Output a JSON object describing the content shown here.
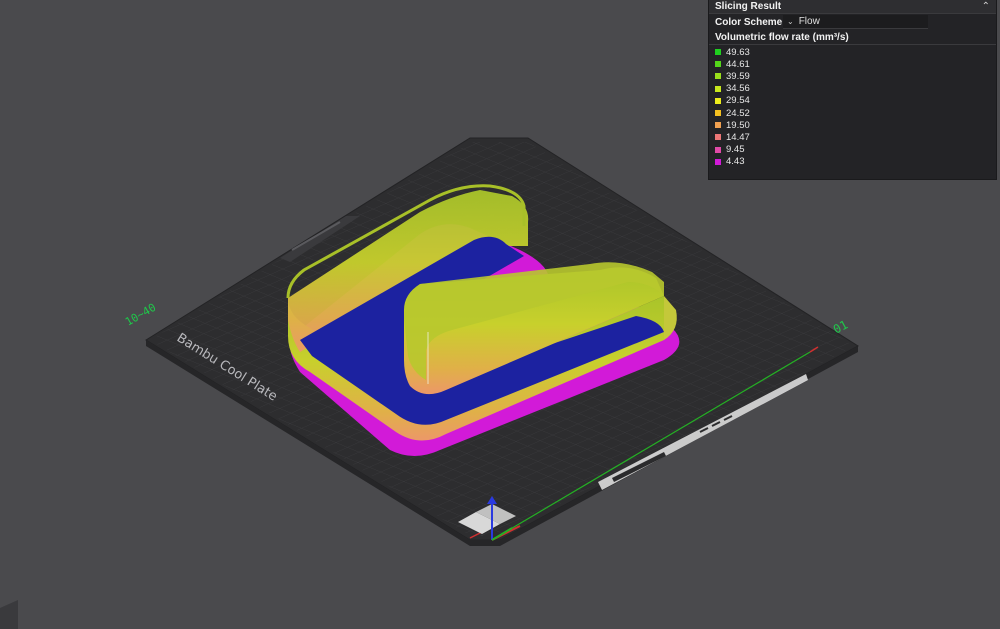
{
  "panel": {
    "title": "Slicing Result",
    "color_scheme_label": "Color Scheme",
    "color_scheme_value": "Flow",
    "legend_title": "Volumetric flow rate (mm³/s)",
    "legend": [
      {
        "value": "49.63",
        "color": "#1fd01f"
      },
      {
        "value": "44.61",
        "color": "#54d61a"
      },
      {
        "value": "39.59",
        "color": "#9ade1c"
      },
      {
        "value": "34.56",
        "color": "#c8e81d"
      },
      {
        "value": "29.54",
        "color": "#ecec1c"
      },
      {
        "value": "24.52",
        "color": "#f4c020"
      },
      {
        "value": "19.50",
        "color": "#f0a050"
      },
      {
        "value": "14.47",
        "color": "#ec7676"
      },
      {
        "value": "9.45",
        "color": "#e04aa8"
      },
      {
        "value": "4.43",
        "color": "#d21ad8"
      }
    ]
  },
  "plate": {
    "brand_text": "Bambu Cool Plate",
    "left_label": "10~40",
    "right_label": "01"
  },
  "colors": {
    "background": "#4a4a4d",
    "plate": "#2e2e30",
    "infill": "#1c22a0",
    "brim": "#d21ad8",
    "wall_top": "#b8d02a",
    "wall_bottom": "#e6a060"
  }
}
